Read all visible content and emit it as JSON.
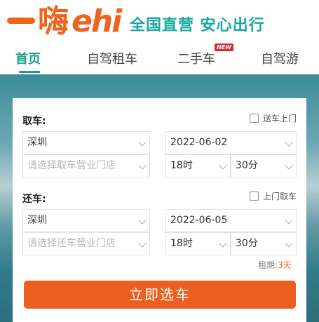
{
  "brand": {
    "logo_text": "一嗨ehi",
    "slogan": "全国直营 安心出行"
  },
  "nav": {
    "items": [
      {
        "label": "首页"
      },
      {
        "label": "自驾租车"
      },
      {
        "label": "二手车",
        "badge": "NEW"
      },
      {
        "label": "自驾游"
      }
    ],
    "active_index": 0
  },
  "pickup": {
    "label": "取车:",
    "delivery_option": "送车上门",
    "city": "深圳",
    "store_placeholder": "请选择取车营业门店",
    "date": "2022-06-02",
    "hour": "18时",
    "minute": "30分"
  },
  "return": {
    "label": "还车:",
    "pickup_option": "上门取车",
    "city": "深圳",
    "store_placeholder": "请选择还车营业门店",
    "date": "2022-06-05",
    "hour": "18时",
    "minute": "30分"
  },
  "lease": {
    "label": "租期:",
    "value": "3天"
  },
  "submit_label": "立即选车",
  "colors": {
    "brand_orange": "#f0631c",
    "brand_teal": "#1aa8a0",
    "button": "#ec5f1e"
  }
}
